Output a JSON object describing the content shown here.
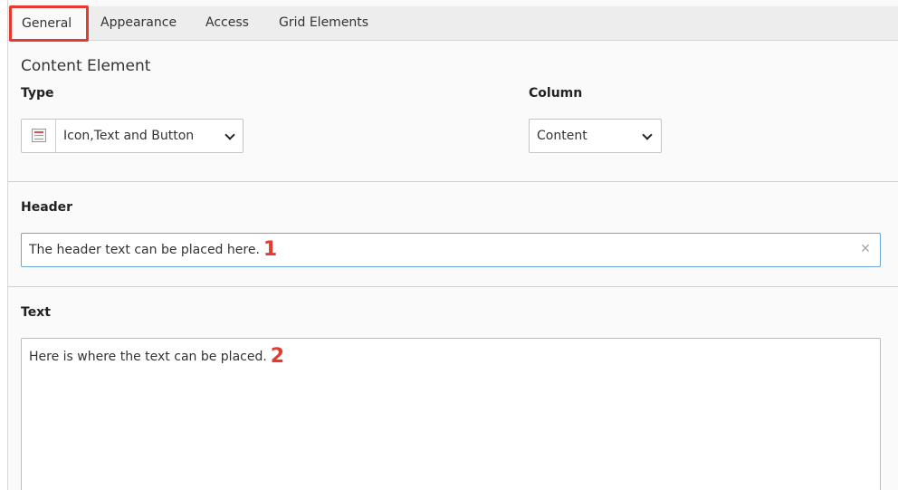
{
  "tabs": [
    {
      "label": "General",
      "active": true
    },
    {
      "label": "Appearance",
      "active": false
    },
    {
      "label": "Access",
      "active": false
    },
    {
      "label": "Grid Elements",
      "active": false
    }
  ],
  "general": {
    "section_title": "Content Element",
    "type": {
      "label": "Type",
      "selected": "Icon,Text and Button",
      "icon": "content-element-icon"
    },
    "column": {
      "label": "Column",
      "selected": "Content"
    }
  },
  "header": {
    "label": "Header",
    "value": "The header text can be placed here.",
    "marker": "1"
  },
  "text": {
    "label": "Text",
    "value": "Here is where the text can be placed.",
    "marker": "2"
  },
  "colors": {
    "highlight": "#e53a2f",
    "focus_border": "#6aa6d6"
  }
}
